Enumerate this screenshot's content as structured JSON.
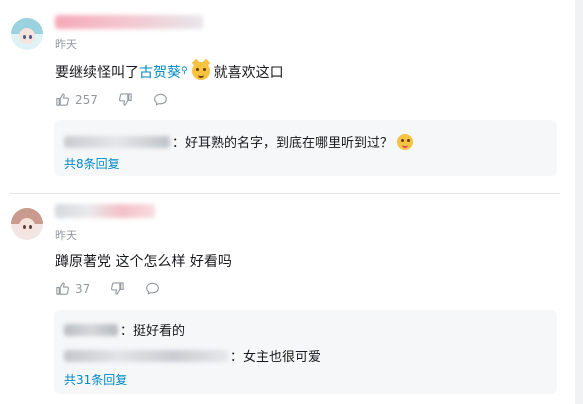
{
  "comments": [
    {
      "time": "昨天",
      "content_before": "要继续怪叫了",
      "link": "古贺葵",
      "content_after": "就喜欢这口",
      "likes": "257",
      "replies": [
        {
          "text": "：好耳熟的名字，到底在哪里听到过？"
        }
      ],
      "reply_count": "共8条回复"
    },
    {
      "time": "昨天",
      "content": "蹲原著党 这个怎么样 好看吗",
      "likes": "37",
      "replies": [
        {
          "text": "：挺好看的"
        },
        {
          "text": "：女主也很可爱"
        }
      ],
      "reply_count": "共31条回复"
    }
  ],
  "colors": {
    "link": "#008ac5",
    "meta": "#9499a0",
    "reply_bg": "#f6f7f8"
  },
  "icons": [
    "thumb-up-icon",
    "thumb-down-icon",
    "reply-icon",
    "search-icon"
  ]
}
